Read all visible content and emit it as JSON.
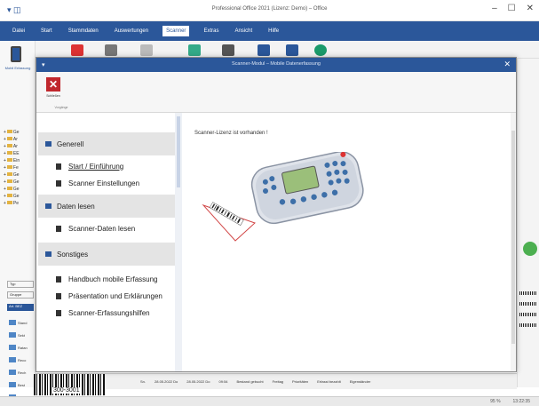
{
  "window": {
    "title": "Professional Office 2021 (Lizenz: Demo) – Office"
  },
  "menubar": {
    "items": [
      "Datei",
      "Start",
      "Stammdaten",
      "Auswertungen",
      "Scanner",
      "Extras",
      "Ansicht",
      "Hilfe"
    ],
    "active_index": 4
  },
  "left_nav": {
    "label": "Mobil Erfassung",
    "tree_items": [
      "Ge",
      "Ar",
      "Ar",
      "EE",
      "Ein",
      "Fe",
      "Ge",
      "Ge",
      "Ge",
      "Ge",
      "Pe"
    ],
    "search_placeholder": "Typ",
    "group_label": "Gruppe",
    "list_header": "Art. BEZ",
    "list_items": [
      "Stand",
      "Sekt",
      "Ratan",
      "Reco",
      "Rech",
      "Best",
      "Preis"
    ]
  },
  "dialog": {
    "title": "Scanner-Modul – Mobile Datenerfassung",
    "ribbon": {
      "close_label": "Schließen",
      "group_label": "Vorgänge"
    },
    "sections": [
      {
        "title": "Generell",
        "links": [
          "Start / Einführung",
          "Scanner Einstellungen"
        ]
      },
      {
        "title": "Daten lesen",
        "links": [
          "Scanner-Daten lesen"
        ]
      },
      {
        "title": "Sonstiges",
        "links": [
          "Handbuch mobile Erfassung",
          "Präsentation und Erklärungen",
          "Scanner-Erfassungshilfen"
        ]
      }
    ],
    "active_link": "Start / Einführung",
    "content_message": "Scanner-Lizenz ist vorhanden !"
  },
  "statusbar": {
    "cells": [
      "Sn.",
      "28.05.2022 Do",
      "28.05.2022 Do",
      "09:54",
      "Bestand gebucht",
      "Freitag",
      "Prioritäten",
      "Erfasst bezahlt",
      "Eigenständer"
    ]
  },
  "barcode_label": "300-3001",
  "bottom_status": [
    "95 %",
    "13:22:35"
  ],
  "colors": {
    "accent": "#2b579a",
    "close_red": "#c0272d",
    "section_bg": "#e4e4e4"
  }
}
